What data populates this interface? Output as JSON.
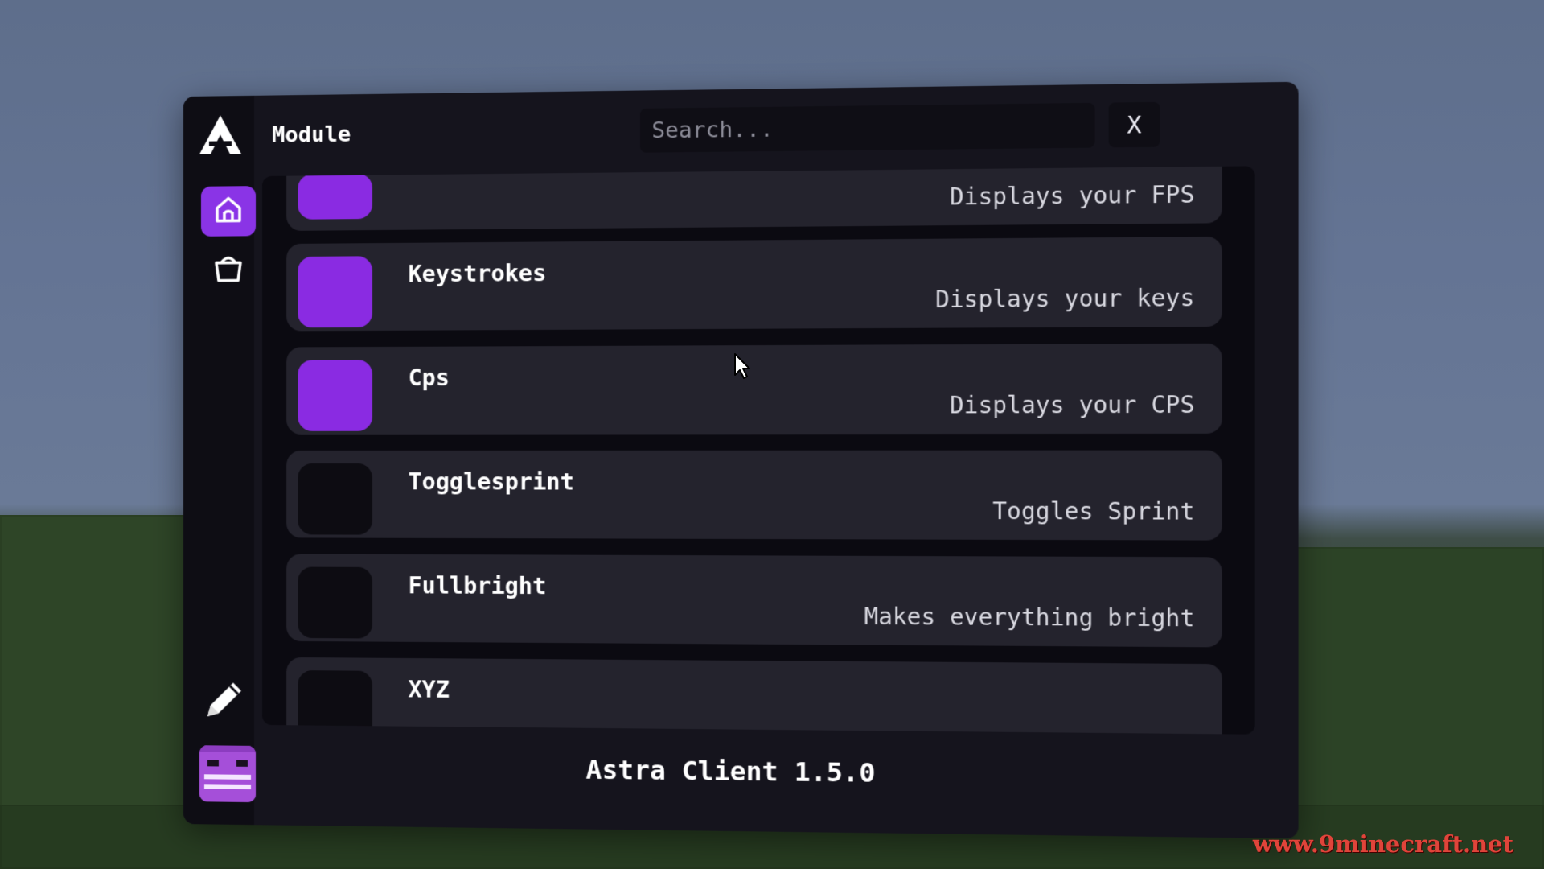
{
  "app": {
    "title": "Module",
    "version": "Astra Client 1.5.0"
  },
  "search": {
    "placeholder": "Search...",
    "value": ""
  },
  "close_label": "X",
  "sidebar": {
    "items": [
      {
        "icon": "home-icon",
        "active": true
      },
      {
        "icon": "bag-icon",
        "active": false
      }
    ],
    "bottom": [
      {
        "icon": "pencil-icon"
      },
      {
        "icon": "avatar-icon"
      }
    ]
  },
  "modules": [
    {
      "name": "",
      "description": "Displays your FPS",
      "enabled": true
    },
    {
      "name": "Keystrokes",
      "description": "Displays your keys",
      "enabled": true
    },
    {
      "name": "Cps",
      "description": "Displays your CPS",
      "enabled": true
    },
    {
      "name": "Togglesprint",
      "description": "Toggles Sprint",
      "enabled": false
    },
    {
      "name": "Fullbright",
      "description": "Makes everything bright",
      "enabled": false
    },
    {
      "name": "XYZ",
      "description": "",
      "enabled": false
    }
  ],
  "colors": {
    "accent": "#8a2be2",
    "panel": "#15141d",
    "row": "#24232d"
  },
  "watermark": "www.9minecraft.net"
}
